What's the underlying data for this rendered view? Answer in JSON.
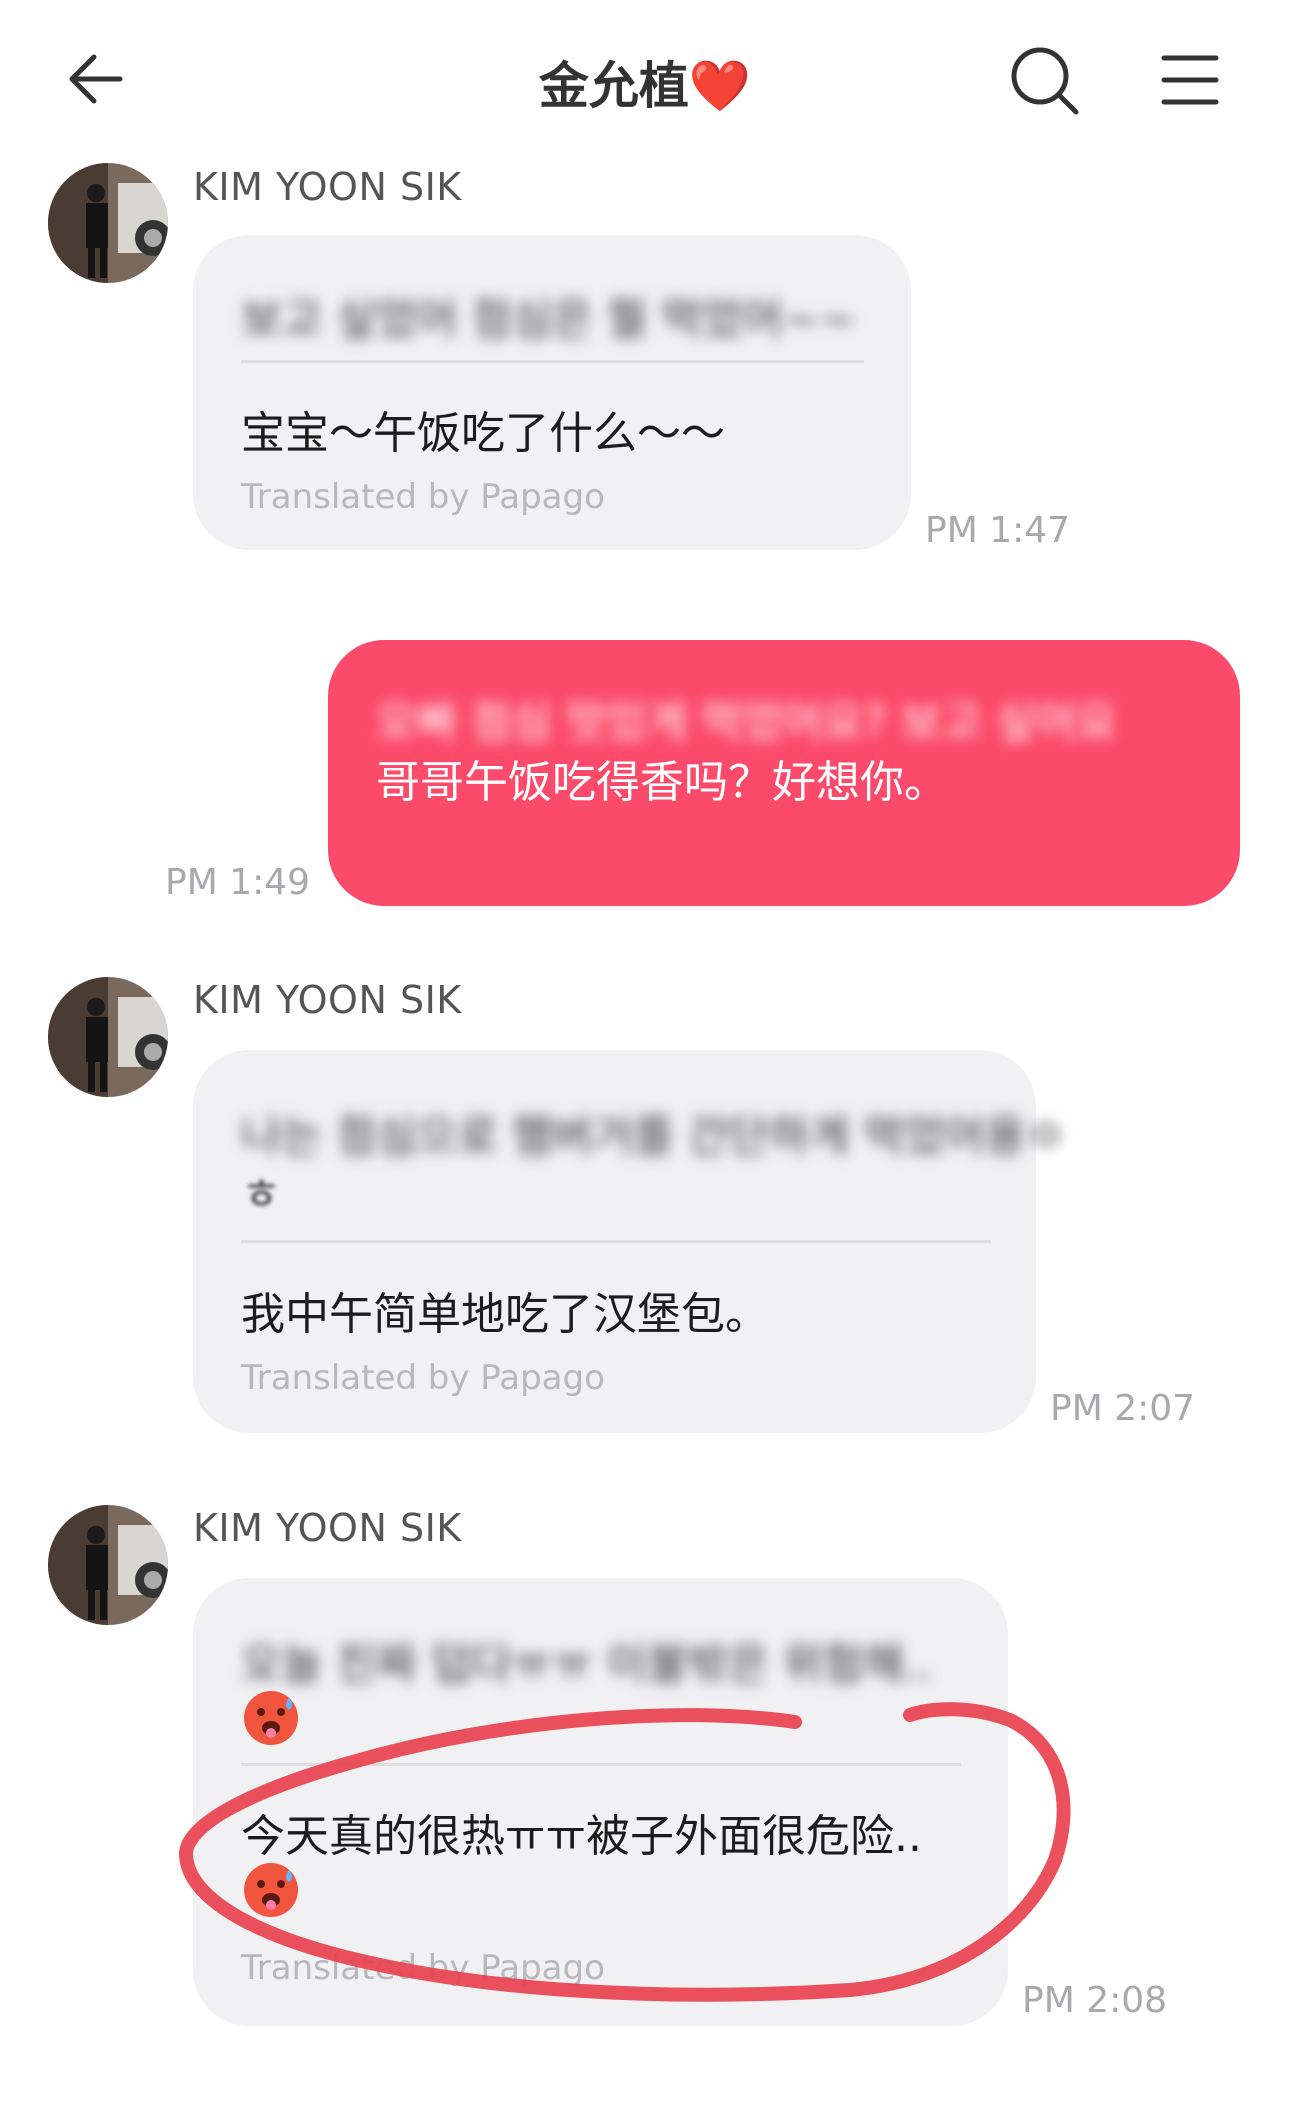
{
  "header": {
    "title": "金允植",
    "title_emoji": "❤️",
    "back_icon": "back-arrow-icon",
    "search_icon": "search-icon",
    "menu_icon": "menu-icon"
  },
  "messages": [
    {
      "direction": "incoming",
      "sender": "KIM YOON SIK",
      "original_obscured": "보고 싶었어 점심은 뭘 먹었어~~",
      "translation": "宝宝～午饭吃了什么～～",
      "translated_by": "Translated by Papago",
      "time": "PM 1:47"
    },
    {
      "direction": "outgoing",
      "original_obscured": "오빠 점심 맛있게 먹었어요? 보고 싶어요",
      "translation": "哥哥午饭吃得香吗？好想你。",
      "time": "PM 1:49"
    },
    {
      "direction": "incoming",
      "sender": "KIM YOON SIK",
      "original_obscured": "나는 점심으로 햄버거를 간단하게 먹었어용ㅇ",
      "original_obscured_line2": "ㅎ",
      "translation": "我中午简单地吃了汉堡包。",
      "translated_by": "Translated by Papago",
      "time": "PM 2:07"
    },
    {
      "direction": "incoming",
      "sender": "KIM YOON SIK",
      "original_obscured": "오늘 진짜 덥다ㅠㅠ 이불밖은 위험해..",
      "translation": "今天真的很热ㅠㅠ被子外面很危险..",
      "translated_by": "Translated by Papago",
      "time": "PM 2:08",
      "emoji_icon": "hot-face-emoji-icon"
    }
  ],
  "colors": {
    "outgoing_bubble": "#fb4a6a",
    "incoming_bubble": "#f1f1f4",
    "annotation_circle": "#e8424e"
  }
}
